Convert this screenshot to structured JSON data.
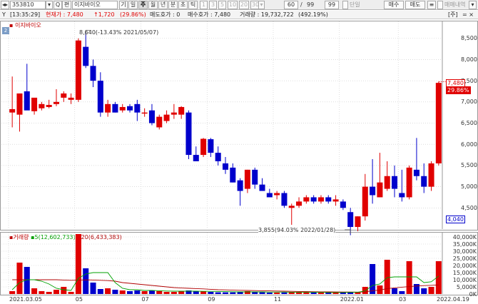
{
  "toolbar": {
    "menu_icon": "◂▸",
    "code_value": "353810",
    "stepper_icon": "▾",
    "search_icon": "Q",
    "name_prefix": "편",
    "stock_name": "이지바이오",
    "period_gi": "기",
    "period_buttons": [
      "일",
      "주",
      "월",
      "년",
      "분",
      "초",
      "틱"
    ],
    "period_selected": "주",
    "minute_buttons": [
      "1",
      "3",
      "5",
      "10",
      "20",
      "30"
    ],
    "minute_more": "▾",
    "count_value": "60",
    "count_slash": "/",
    "count_total": "99",
    "count2_value": "99",
    "danil_label": "단일",
    "buy_button": "매수",
    "sell_button": "매도",
    "tool_icon": "≡",
    "trade_label": "매매내역",
    "window_icon": "▾"
  },
  "infobar": {
    "mode": "Y",
    "time": "[13:35:29]",
    "price_label": "현재가 : 7,480",
    "change_label": "↑1,720",
    "pct_label": "(29.86%)",
    "ask_label": "매도호가 : 0",
    "bid_label": "매수호가 : 7,480",
    "volume_label": "거래량 : 19,732,722",
    "volume_pct": "(492.19%)",
    "unit": "[주]",
    "tools": "= ×"
  },
  "price_panel": {
    "badge": "2",
    "legend": "이지바이오",
    "y_labels": [
      "8,500",
      "8,000",
      "7,500",
      "7,000",
      "6,500",
      "6,000",
      "5,500",
      "5,000",
      "4,500"
    ],
    "current_price_tag": "7,480",
    "current_pct_tag": "29.86%",
    "low_tag": "4,040",
    "max_annotation": "8,640(-13.43% 2021/05/07)",
    "min_annotation": "3,855(94.03% 2022/01/28)"
  },
  "volume_panel": {
    "legend_main": "거래량",
    "legend_ma5": "5(12,602,733)",
    "legend_ma20": "20(6,433,383)",
    "y_labels": [
      "40,000K",
      "35,000K",
      "30,000K",
      "25,000K",
      "20,000K",
      "15,000K",
      "10,000K",
      "5,000K",
      "0K"
    ]
  },
  "x_axis": {
    "labels": [
      "2021.03.05",
      "05",
      "07",
      "09",
      "11",
      "2022.01",
      "03",
      "2022.04.19"
    ]
  },
  "colors": {
    "up": "#e00000",
    "down": "#0000cc",
    "ma5": "#00a000",
    "ma20": "#b00000"
  },
  "chart_data": {
    "type": "candlestick",
    "price_range": [
      4000,
      8900
    ],
    "volume_range": [
      0,
      43000
    ],
    "candles": [
      {
        "o": 6750,
        "h": 7600,
        "l": 6400,
        "c": 6830,
        "v": 2000
      },
      {
        "o": 6700,
        "h": 7200,
        "l": 6300,
        "c": 7200,
        "v": 22000
      },
      {
        "o": 7250,
        "h": 7900,
        "l": 6850,
        "c": 6800,
        "v": 19000
      },
      {
        "o": 6780,
        "h": 7000,
        "l": 6700,
        "c": 7100,
        "v": 4000
      },
      {
        "o": 6850,
        "h": 7000,
        "l": 6800,
        "c": 6950,
        "v": 2000
      },
      {
        "o": 6880,
        "h": 7050,
        "l": 6850,
        "c": 6930,
        "v": 1500
      },
      {
        "o": 6950,
        "h": 7300,
        "l": 6900,
        "c": 7000,
        "v": 3000
      },
      {
        "o": 7100,
        "h": 7250,
        "l": 7000,
        "c": 7200,
        "v": 5000
      },
      {
        "o": 7050,
        "h": 7200,
        "l": 6950,
        "c": 7100,
        "v": 1500
      },
      {
        "o": 7050,
        "h": 8500,
        "l": 7000,
        "c": 8450,
        "v": 42000
      },
      {
        "o": 8300,
        "h": 8640,
        "l": 7800,
        "c": 7850,
        "v": 18000
      },
      {
        "o": 7850,
        "h": 8000,
        "l": 7350,
        "c": 7500,
        "v": 8000
      },
      {
        "o": 7500,
        "h": 7700,
        "l": 6650,
        "c": 6750,
        "v": 3500
      },
      {
        "o": 6750,
        "h": 7050,
        "l": 6650,
        "c": 6950,
        "v": 4000
      },
      {
        "o": 6950,
        "h": 7000,
        "l": 6750,
        "c": 6750,
        "v": 3000
      },
      {
        "o": 6800,
        "h": 6950,
        "l": 6750,
        "c": 6880,
        "v": 2500
      },
      {
        "o": 6900,
        "h": 6950,
        "l": 6750,
        "c": 6800,
        "v": 2000
      },
      {
        "o": 6950,
        "h": 7050,
        "l": 6550,
        "c": 6750,
        "v": 2500
      },
      {
        "o": 6750,
        "h": 6850,
        "l": 6650,
        "c": 6750,
        "v": 2000
      },
      {
        "o": 6800,
        "h": 6950,
        "l": 6450,
        "c": 6500,
        "v": 2500
      },
      {
        "o": 6400,
        "h": 6700,
        "l": 6350,
        "c": 6650,
        "v": 2000
      },
      {
        "o": 6550,
        "h": 6800,
        "l": 6500,
        "c": 6700,
        "v": 1500
      },
      {
        "o": 6700,
        "h": 6950,
        "l": 6600,
        "c": 6750,
        "v": 1500
      },
      {
        "o": 6700,
        "h": 6900,
        "l": 6600,
        "c": 6880,
        "v": 2000
      },
      {
        "o": 6750,
        "h": 6800,
        "l": 5650,
        "c": 5750,
        "v": 2500
      },
      {
        "o": 5750,
        "h": 5950,
        "l": 5600,
        "c": 5600,
        "v": 1800
      },
      {
        "o": 5750,
        "h": 6150,
        "l": 5700,
        "c": 6130,
        "v": 2000
      },
      {
        "o": 6120,
        "h": 6150,
        "l": 5700,
        "c": 5800,
        "v": 1500
      },
      {
        "o": 5800,
        "h": 5950,
        "l": 5500,
        "c": 5600,
        "v": 1200
      },
      {
        "o": 5550,
        "h": 5700,
        "l": 5300,
        "c": 5400,
        "v": 1200
      },
      {
        "o": 5450,
        "h": 5550,
        "l": 5100,
        "c": 5100,
        "v": 1200
      },
      {
        "o": 5150,
        "h": 5200,
        "l": 4550,
        "c": 4900,
        "v": 1500
      },
      {
        "o": 4950,
        "h": 5400,
        "l": 4850,
        "c": 5400,
        "v": 2000
      },
      {
        "o": 5400,
        "h": 5450,
        "l": 4950,
        "c": 5050,
        "v": 1500
      },
      {
        "o": 5050,
        "h": 5200,
        "l": 4900,
        "c": 4900,
        "v": 1200
      },
      {
        "o": 4850,
        "h": 4950,
        "l": 4750,
        "c": 4750,
        "v": 1000
      },
      {
        "o": 4800,
        "h": 4900,
        "l": 4700,
        "c": 4850,
        "v": 1000
      },
      {
        "o": 4850,
        "h": 4900,
        "l": 4500,
        "c": 4550,
        "v": 1100
      },
      {
        "o": 4500,
        "h": 4600,
        "l": 4100,
        "c": 4550,
        "v": 1500
      },
      {
        "o": 4550,
        "h": 4750,
        "l": 4500,
        "c": 4650,
        "v": 1200
      },
      {
        "o": 4650,
        "h": 4800,
        "l": 4600,
        "c": 4750,
        "v": 1200
      },
      {
        "o": 4750,
        "h": 4800,
        "l": 4600,
        "c": 4650,
        "v": 1000
      },
      {
        "o": 4650,
        "h": 4800,
        "l": 4600,
        "c": 4750,
        "v": 1000
      },
      {
        "o": 4750,
        "h": 4800,
        "l": 4600,
        "c": 4650,
        "v": 1000
      },
      {
        "o": 4650,
        "h": 4800,
        "l": 4550,
        "c": 4700,
        "v": 1000
      },
      {
        "o": 4650,
        "h": 4700,
        "l": 4450,
        "c": 4500,
        "v": 1000
      },
      {
        "o": 4400,
        "h": 4500,
        "l": 3855,
        "c": 4050,
        "v": 1500
      },
      {
        "o": 4050,
        "h": 4300,
        "l": 3950,
        "c": 4300,
        "v": 1500
      },
      {
        "o": 4300,
        "h": 5300,
        "l": 4200,
        "c": 5000,
        "v": 5000
      },
      {
        "o": 5000,
        "h": 5650,
        "l": 4600,
        "c": 4800,
        "v": 21000
      },
      {
        "o": 4750,
        "h": 5800,
        "l": 4750,
        "c": 5100,
        "v": 6000
      },
      {
        "o": 4950,
        "h": 5600,
        "l": 4900,
        "c": 5250,
        "v": 24000
      },
      {
        "o": 5250,
        "h": 5500,
        "l": 4750,
        "c": 4950,
        "v": 4000
      },
      {
        "o": 4850,
        "h": 5400,
        "l": 4650,
        "c": 4750,
        "v": 2000
      },
      {
        "o": 4750,
        "h": 5500,
        "l": 4700,
        "c": 5450,
        "v": 23000
      },
      {
        "o": 5400,
        "h": 6150,
        "l": 5150,
        "c": 5250,
        "v": 7000
      },
      {
        "o": 5250,
        "h": 5550,
        "l": 4850,
        "c": 5000,
        "v": 4000
      },
      {
        "o": 5000,
        "h": 5600,
        "l": 4900,
        "c": 5550,
        "v": 5000
      },
      {
        "o": 5550,
        "h": 7480,
        "l": 5500,
        "c": 7450,
        "v": 23000
      }
    ],
    "ma5": [
      3000,
      8000,
      10000,
      10000,
      9000,
      7000,
      4000,
      3000,
      2500,
      11000,
      14000,
      15000,
      15000,
      15000,
      8000,
      4000,
      3000,
      3000,
      2500,
      2500,
      2300,
      2100,
      2000,
      2000,
      2000,
      2000,
      1900,
      1900,
      1800,
      1700,
      1600,
      1500,
      1500,
      1500,
      1500,
      1400,
      1400,
      1400,
      1300,
      1300,
      1300,
      1200,
      1200,
      1100,
      1100,
      1100,
      1200,
      1200,
      2200,
      6000,
      7000,
      11500,
      12000,
      12000,
      12000,
      12000,
      8000,
      8600,
      12600
    ],
    "ma20": [
      10000,
      10000,
      10000,
      10000,
      10000,
      10000,
      10000,
      9800,
      9600,
      9800,
      9900,
      9800,
      9600,
      9400,
      9000,
      8000,
      7500,
      7000,
      6500,
      6000,
      5500,
      5000,
      4500,
      4200,
      4000,
      3800,
      3600,
      3300,
      3000,
      2900,
      2700,
      2600,
      2500,
      2400,
      2300,
      2200,
      2100,
      2000,
      1900,
      1800,
      1700,
      1600,
      1550,
      1500,
      1450,
      1400,
      1400,
      1350,
      1500,
      2300,
      2800,
      3800,
      4300,
      4800,
      5200,
      5600,
      5900,
      6100,
      6400
    ]
  }
}
